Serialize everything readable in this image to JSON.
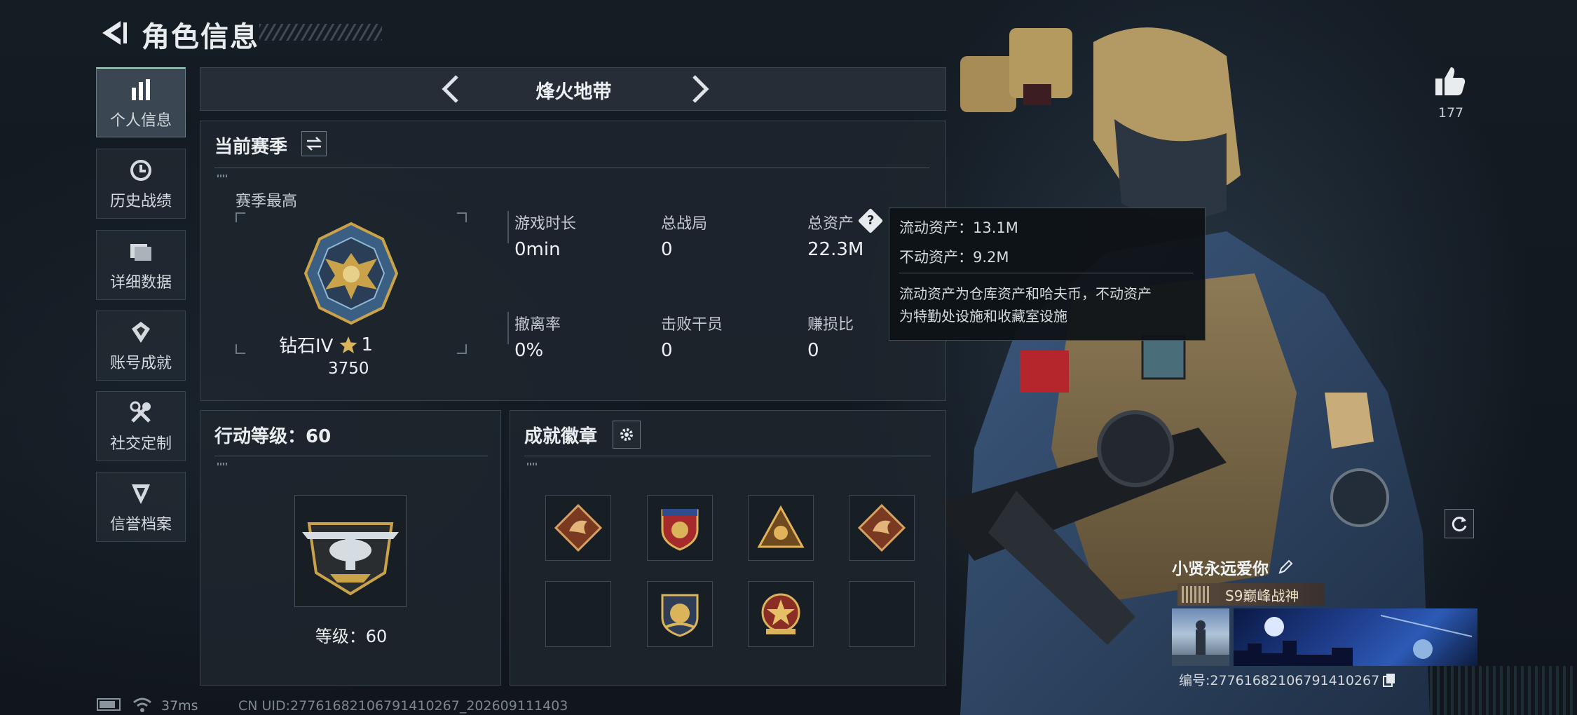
{
  "header": {
    "title": "角色信息"
  },
  "sidebar": {
    "items": [
      {
        "label": "个人信息",
        "icon": "bar-chart-icon",
        "active": true
      },
      {
        "label": "历史战绩",
        "icon": "history-clock-icon",
        "active": false
      },
      {
        "label": "详细数据",
        "icon": "folder-icon",
        "active": false
      },
      {
        "label": "账号成就",
        "icon": "achievement-icon",
        "active": false
      },
      {
        "label": "社交定制",
        "icon": "tools-icon",
        "active": false
      },
      {
        "label": "信誉档案",
        "icon": "reputation-icon",
        "active": false
      }
    ]
  },
  "mode": {
    "title": "烽火地带"
  },
  "season": {
    "title": "当前赛季",
    "best_label": "赛季最高",
    "rank_name": "钻石IV",
    "rank_stars": "1",
    "rank_points": "3750",
    "stats": [
      {
        "label": "游戏时长",
        "value": "0min"
      },
      {
        "label": "总战局",
        "value": "0"
      },
      {
        "label": "总资产",
        "value": "22.3M"
      },
      {
        "label": "撤离率",
        "value": "0%"
      },
      {
        "label": "击败干员",
        "value": "0"
      },
      {
        "label": "赚损比",
        "value": "0"
      }
    ]
  },
  "tooltip": {
    "liquid": "流动资产：13.1M",
    "fixed": "不动资产：9.2M",
    "note_line1": "流动资产为仓库资产和哈夫币，不动资产",
    "note_line2": "为特勤处设施和收藏室设施"
  },
  "action_level": {
    "title": "行动等级：60",
    "level_text": "等级：60"
  },
  "badges": {
    "title": "成就徽章",
    "slots": [
      {
        "icon": "dragon-badge-icon"
      },
      {
        "icon": "shield-badge-icon"
      },
      {
        "icon": "triangle-badge-icon"
      },
      {
        "icon": "dragon-badge-icon"
      },
      {
        "icon": ""
      },
      {
        "icon": "round-emblem-badge-icon"
      },
      {
        "icon": "star-emblem-badge-icon"
      },
      {
        "icon": ""
      }
    ]
  },
  "likes": {
    "count": "177"
  },
  "profile": {
    "name": "小贤永远爱你",
    "title_badge": "S9巅峰战神",
    "id_text": "编号:27761682106791410267"
  },
  "status_bar": {
    "ping": "37ms",
    "uid": "CN UID:27761682106791410267_202609111403"
  },
  "colors": {
    "accent_green": "#9fd9c2",
    "gold": "#c9a24a",
    "panel_bg": "#1e262e"
  }
}
